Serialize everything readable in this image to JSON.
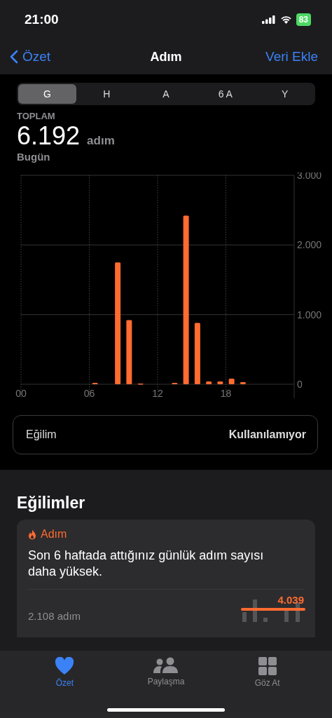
{
  "status_bar": {
    "time": "21:00",
    "battery": "83"
  },
  "nav": {
    "back": "Özet",
    "title": "Adım",
    "action": "Veri Ekle"
  },
  "segments": [
    {
      "label": "G",
      "selected": true
    },
    {
      "label": "H",
      "selected": false
    },
    {
      "label": "A",
      "selected": false
    },
    {
      "label": "6 A",
      "selected": false
    },
    {
      "label": "Y",
      "selected": false
    }
  ],
  "summary": {
    "label": "TOPLAM",
    "value": "6.192",
    "unit": "adım",
    "period": "Bugün"
  },
  "chart_data": {
    "type": "bar",
    "x": [
      0.5,
      1.5,
      2.5,
      3.5,
      4.5,
      5.5,
      6.5,
      7.5,
      8.5,
      9.5,
      10.5,
      11.5,
      12.5,
      13.5,
      14.5,
      15.5,
      16.5,
      17.5,
      18.5,
      19.5,
      20.5,
      21.5,
      22.5,
      23.5
    ],
    "xlim": [
      0,
      24
    ],
    "grid": true,
    "series": [
      {
        "color": "#ff6b30",
        "values": [
          0,
          0,
          0,
          0,
          0,
          0,
          20,
          0,
          1750,
          920,
          10,
          0,
          0,
          20,
          2420,
          880,
          40,
          40,
          80,
          30,
          0,
          0,
          0,
          0
        ]
      }
    ],
    "ylim": [
      0,
      3000
    ],
    "yticks": [
      {
        "value": 0,
        "label": "0"
      },
      {
        "value": 1000,
        "label": "1.000"
      },
      {
        "value": 2000,
        "label": "2.000"
      },
      {
        "value": 3000,
        "label": "3.000"
      }
    ],
    "xticks": [
      {
        "value": 0,
        "label": "00"
      },
      {
        "value": 6,
        "label": "06"
      },
      {
        "value": 12,
        "label": "12"
      },
      {
        "value": 18,
        "label": "18"
      }
    ]
  },
  "trend_row": {
    "label": "Eğilim",
    "value": "Kullanılamıyor"
  },
  "trends": {
    "title": "Eğilimler",
    "card": {
      "category": "Adım",
      "text": "Son 6 haftada attığınız günlük adım sayısı daha yüksek.",
      "left_value": "2.108 adım",
      "right_value": "4.039"
    }
  },
  "tab_bar": [
    {
      "label": "Özet",
      "selected": true
    },
    {
      "label": "Paylaşma",
      "selected": false
    },
    {
      "label": "Göz At",
      "selected": false
    }
  ]
}
